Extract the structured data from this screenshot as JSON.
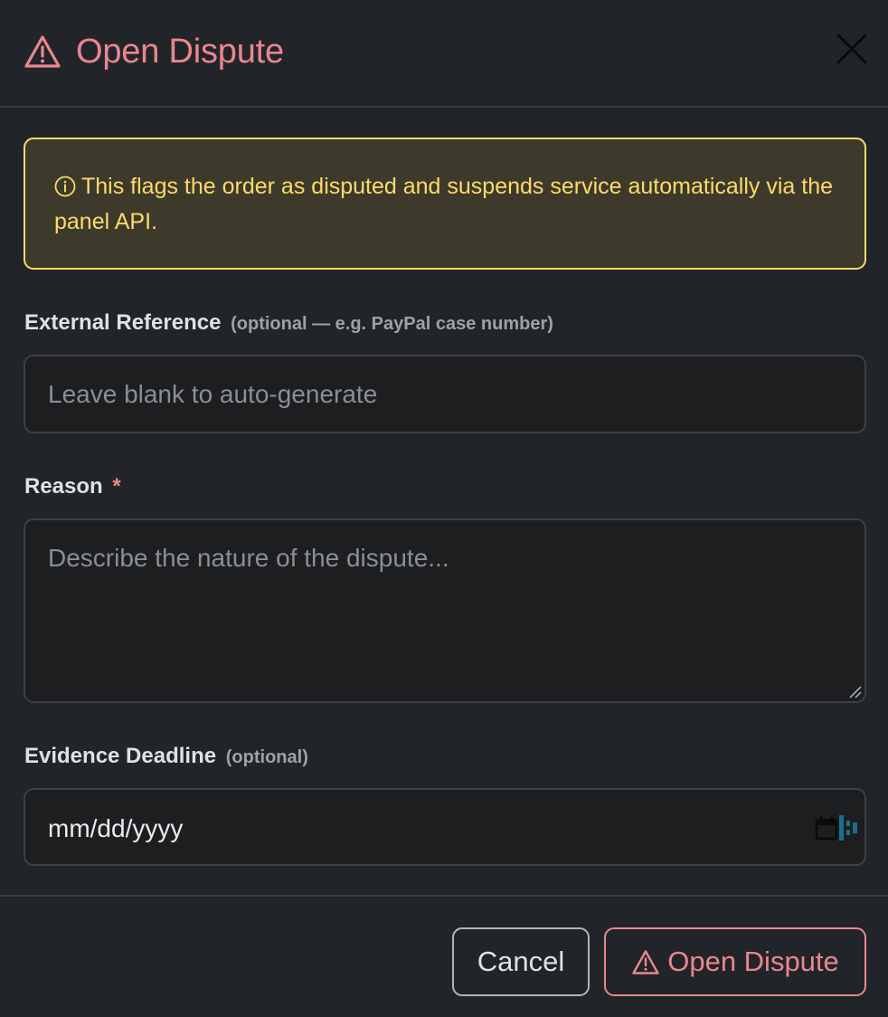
{
  "header": {
    "title": "Open Dispute",
    "title_icon": "warning-triangle-icon",
    "close_icon": "close-icon"
  },
  "alert": {
    "icon": "info-circle-icon",
    "text": "This flags the order as disputed and suspends service automatically via the panel API."
  },
  "fields": {
    "external_reference": {
      "label": "External Reference",
      "hint": "(optional — e.g. PayPal case number)",
      "placeholder": "Leave blank to auto-generate",
      "value": ""
    },
    "reason": {
      "label": "Reason",
      "required_mark": "*",
      "placeholder": "Describe the nature of the dispute...",
      "value": ""
    },
    "evidence_deadline": {
      "label": "Evidence Deadline",
      "hint": "(optional)",
      "value_display": "mm/dd/yyyy",
      "icon": "calendar-icon"
    }
  },
  "footer": {
    "cancel_label": "Cancel",
    "submit_label": "Open Dispute",
    "submit_icon": "warning-triangle-icon"
  },
  "colors": {
    "background": "#212529",
    "danger": "#ea868f",
    "warning": "#ffda6a",
    "warning_bg": "#3d3a2c",
    "input_bg": "#1d1e20",
    "text": "#dee2e6",
    "muted": "#9da2a6"
  }
}
